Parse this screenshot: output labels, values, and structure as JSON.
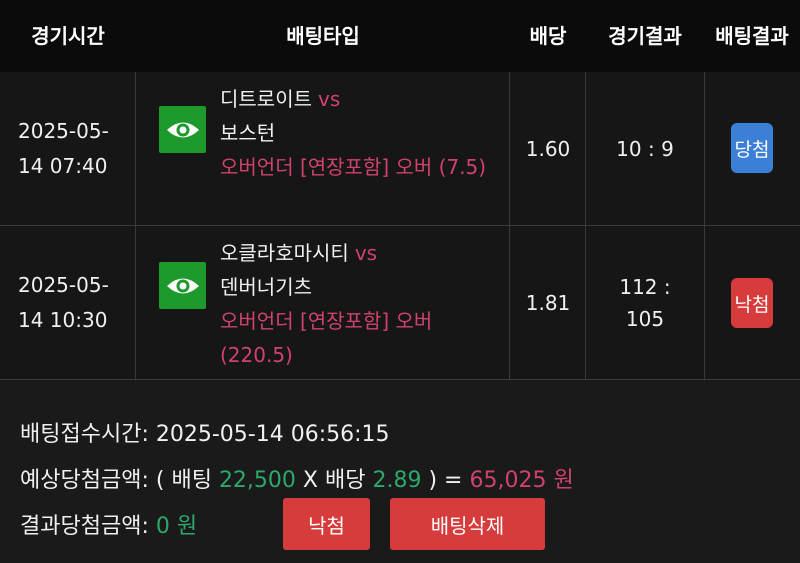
{
  "header": {
    "time": "경기시간",
    "type": "배팅타입",
    "odds": "배당",
    "result": "경기결과",
    "bet_result": "배팅결과"
  },
  "rows": [
    {
      "time": "2025-05-14 07:40",
      "home": "디트로이트",
      "vs": "vs",
      "away": "보스턴",
      "market": "오버언더 [연장포함] 오버 (7.5)",
      "odds": "1.60",
      "result": "10 : 9",
      "status": "당첨",
      "status_color": "#3b7fd6"
    },
    {
      "time": "2025-05-14 10:30",
      "home": "오클라호마시티",
      "vs": "vs",
      "away": "덴버너기츠",
      "market": "오버언더 [연장포함] 오버 (220.5)",
      "odds": "1.81",
      "result": "112 : 105",
      "status": "낙첨",
      "status_color": "#d83b3b"
    }
  ],
  "icons": {
    "view": "eye-icon"
  },
  "summary": {
    "received_label": "배팅접수시간:",
    "received_value": "2025-05-14 06:56:15",
    "expected_label": "예상당첨금액:",
    "open_paren": "(",
    "bet_label": "배팅",
    "bet_amount": "22,500",
    "times": "X",
    "odds_label": "배당",
    "total_odds": "2.89",
    "close_eq": ") =",
    "expected_amount": "65,025 원",
    "result_label": "결과당첨금액:",
    "result_amount": "0 원",
    "lose_button": "낙첨",
    "delete_button": "배팅삭제"
  },
  "colors": {
    "accent_pink": "#d0426c",
    "accent_green": "#2ea86a",
    "button_red": "#d63c3c",
    "icon_green": "#1e9a2c"
  }
}
